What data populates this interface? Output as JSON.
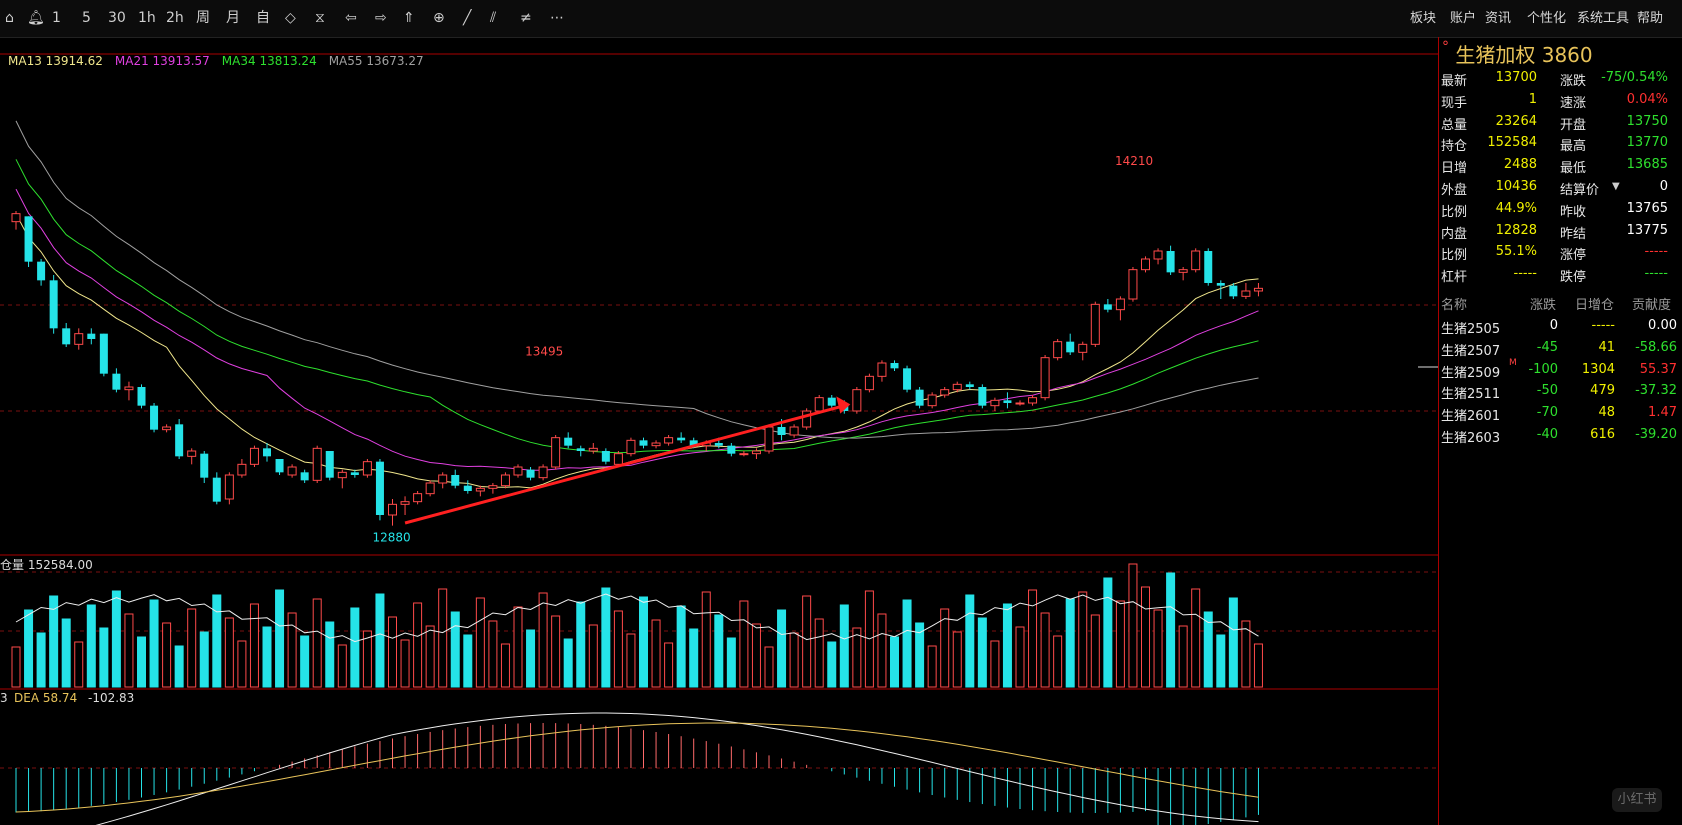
{
  "toolbar": {
    "tools": [
      "house-icon",
      "bell-icon",
      "1",
      "5",
      "30",
      "1h",
      "2h",
      "周",
      "月",
      "自",
      "diamond-icon",
      "hourglass-icon",
      "arrow-left-icon",
      "arrow-right-icon",
      "chevrons-up-icon",
      "crosshair-icon",
      "line-icon",
      "parallel-icon",
      "double-line-icon",
      "more-icon"
    ],
    "menu": [
      "板块",
      "账户",
      "资讯",
      "个性化",
      "系统工具",
      "帮助"
    ]
  },
  "ma_legend": [
    {
      "text": "MA13 13914.62",
      "color": "#f0e68c"
    },
    {
      "text": "MA21 13913.57",
      "color": "#e040e0"
    },
    {
      "text": "MA34 13813.24",
      "color": "#2ee02e"
    },
    {
      "text": "MA55 13673.27",
      "color": "#a0a0a0"
    }
  ],
  "oi_label": "仓量 152584.00",
  "macd_labels": {
    "left": "3",
    "dea": "DEA 58.74",
    "macd": "-102.83"
  },
  "annotations": {
    "high": "14210",
    "mid": "13495",
    "low": "12880"
  },
  "quote": {
    "title": "生猪加权  3860",
    "rows": [
      {
        "l1": "最新",
        "v1": "13700",
        "c1": "#f0f000",
        "l2": "涨跌",
        "v2": "-75/0.54%",
        "c2": "#2ee02e"
      },
      {
        "l1": "现手",
        "v1": "1",
        "c1": "#f0f000",
        "l2": "速涨",
        "v2": "0.04%",
        "c2": "#ff3030"
      },
      {
        "l1": "总量",
        "v1": "23264",
        "c1": "#f0f000",
        "l2": "开盘",
        "v2": "13750",
        "c2": "#2ee02e"
      },
      {
        "l1": "持仓",
        "v1": "152584",
        "c1": "#f0f000",
        "l2": "最高",
        "v2": "13770",
        "c2": "#2ee02e"
      },
      {
        "l1": "日增",
        "v1": "2488",
        "c1": "#f0f000",
        "l2": "最低",
        "v2": "13685",
        "c2": "#2ee02e"
      },
      {
        "l1": "外盘",
        "v1": "10436",
        "c1": "#f0f000",
        "l2": "结算价",
        "v2": "0",
        "c2": "#ffffff"
      },
      {
        "l1": "比例",
        "v1": "44.9%",
        "c1": "#f0f000",
        "l2": "昨收",
        "v2": "13765",
        "c2": "#ffffff"
      },
      {
        "l1": "内盘",
        "v1": "12828",
        "c1": "#f0f000",
        "l2": "昨结",
        "v2": "13775",
        "c2": "#ffffff"
      },
      {
        "l1": "比例",
        "v1": "55.1%",
        "c1": "#f0f000",
        "l2": "涨停",
        "v2": "-----",
        "c2": "#ff3030"
      },
      {
        "l1": "杠杆",
        "v1": "-----",
        "c1": "#f0f000",
        "l2": "跌停",
        "v2": "-----",
        "c2": "#2ee02e"
      }
    ],
    "contracts_header": [
      "名称",
      "涨跌",
      "日增仓",
      "贡献度"
    ],
    "contracts": [
      {
        "name": "生猪2505",
        "chg": "0",
        "chgc": "#ffffff",
        "oi": "-----",
        "oic": "#f0f000",
        "contrib": "0.00",
        "cc": "#ffffff"
      },
      {
        "name": "生猪2507",
        "chg": "-45",
        "chgc": "#2ee02e",
        "oi": "41",
        "oic": "#f0f000",
        "contrib": "-58.66",
        "cc": "#2ee02e"
      },
      {
        "name": "生猪2509",
        "mark": "M",
        "chg": "-100",
        "chgc": "#2ee02e",
        "oi": "1304",
        "oic": "#f0f000",
        "contrib": "55.37",
        "cc": "#ff3030"
      },
      {
        "name": "生猪2511",
        "chg": "-50",
        "chgc": "#2ee02e",
        "oi": "479",
        "oic": "#f0f000",
        "contrib": "-37.32",
        "cc": "#2ee02e"
      },
      {
        "name": "生猪2601",
        "chg": "-70",
        "chgc": "#2ee02e",
        "oi": "48",
        "oic": "#f0f000",
        "contrib": "1.47",
        "cc": "#ff3030"
      },
      {
        "name": "生猪2603",
        "chg": "-40",
        "chgc": "#2ee02e",
        "oi": "616",
        "oic": "#f0f000",
        "contrib": "-39.20",
        "cc": "#2ee02e"
      }
    ]
  },
  "watermark": "小红书",
  "chart_data": {
    "type": "candlestick",
    "ylim": [
      12800,
      14600
    ],
    "candles": [
      [
        14020,
        14060,
        13990,
        14050
      ],
      [
        14040,
        14040,
        13850,
        13870
      ],
      [
        13870,
        13880,
        13780,
        13800
      ],
      [
        13800,
        13820,
        13600,
        13620
      ],
      [
        13620,
        13640,
        13550,
        13560
      ],
      [
        13560,
        13620,
        13540,
        13600
      ],
      [
        13600,
        13620,
        13560,
        13580
      ],
      [
        13600,
        13600,
        13440,
        13450
      ],
      [
        13450,
        13470,
        13380,
        13390
      ],
      [
        13390,
        13420,
        13350,
        13400
      ],
      [
        13400,
        13410,
        13320,
        13330
      ],
      [
        13330,
        13340,
        13230,
        13240
      ],
      [
        13240,
        13260,
        13230,
        13250
      ],
      [
        13260,
        13280,
        13130,
        13140
      ],
      [
        13140,
        13170,
        13110,
        13160
      ],
      [
        13150,
        13160,
        13040,
        13060
      ],
      [
        13060,
        13080,
        12960,
        12970
      ],
      [
        12980,
        13080,
        12960,
        13070
      ],
      [
        13070,
        13130,
        13060,
        13110
      ],
      [
        13110,
        13180,
        13100,
        13170
      ],
      [
        13170,
        13190,
        13120,
        13140
      ],
      [
        13130,
        13130,
        13070,
        13080
      ],
      [
        13070,
        13110,
        13060,
        13100
      ],
      [
        13080,
        13090,
        13040,
        13050
      ],
      [
        13050,
        13180,
        13040,
        13170
      ],
      [
        13160,
        13160,
        13050,
        13060
      ],
      [
        13060,
        13090,
        13020,
        13080
      ],
      [
        13080,
        13090,
        13060,
        13070
      ],
      [
        13070,
        13130,
        13060,
        13120
      ],
      [
        13120,
        13130,
        12900,
        12920
      ],
      [
        12920,
        12980,
        12880,
        12960
      ],
      [
        12960,
        12990,
        12920,
        12970
      ],
      [
        12970,
        13010,
        12960,
        13000
      ],
      [
        13000,
        13050,
        12990,
        13040
      ],
      [
        13040,
        13080,
        13020,
        13070
      ],
      [
        13070,
        13090,
        13020,
        13030
      ],
      [
        13030,
        13050,
        13000,
        13010
      ],
      [
        13010,
        13030,
        12990,
        13020
      ],
      [
        13020,
        13040,
        13000,
        13030
      ],
      [
        13030,
        13080,
        13020,
        13070
      ],
      [
        13070,
        13110,
        13060,
        13100
      ],
      [
        13090,
        13100,
        13050,
        13060
      ],
      [
        13060,
        13110,
        13050,
        13100
      ],
      [
        13100,
        13220,
        13090,
        13210
      ],
      [
        13210,
        13230,
        13170,
        13180
      ],
      [
        13170,
        13180,
        13140,
        13160
      ],
      [
        13160,
        13190,
        13150,
        13170
      ],
      [
        13160,
        13170,
        13110,
        13120
      ],
      [
        13110,
        13160,
        13100,
        13150
      ],
      [
        13150,
        13210,
        13140,
        13200
      ],
      [
        13200,
        13210,
        13170,
        13180
      ],
      [
        13180,
        13200,
        13170,
        13190
      ],
      [
        13190,
        13220,
        13180,
        13210
      ],
      [
        13210,
        13230,
        13190,
        13200
      ],
      [
        13200,
        13210,
        13170,
        13180
      ],
      [
        13180,
        13200,
        13160,
        13190
      ],
      [
        13190,
        13210,
        13170,
        13180
      ],
      [
        13180,
        13190,
        13140,
        13150
      ],
      [
        13150,
        13160,
        13140,
        13150
      ],
      [
        13150,
        13170,
        13130,
        13160
      ],
      [
        13160,
        13260,
        13150,
        13250
      ],
      [
        13250,
        13280,
        13200,
        13220
      ],
      [
        13220,
        13260,
        13210,
        13250
      ],
      [
        13250,
        13320,
        13240,
        13310
      ],
      [
        13310,
        13370,
        13300,
        13360
      ],
      [
        13360,
        13370,
        13320,
        13330
      ],
      [
        13330,
        13350,
        13300,
        13310
      ],
      [
        13310,
        13400,
        13300,
        13390
      ],
      [
        13390,
        13450,
        13380,
        13440
      ],
      [
        13440,
        13500,
        13420,
        13490
      ],
      [
        13490,
        13500,
        13460,
        13470
      ],
      [
        13470,
        13480,
        13380,
        13390
      ],
      [
        13390,
        13400,
        13320,
        13330
      ],
      [
        13330,
        13380,
        13320,
        13370
      ],
      [
        13370,
        13400,
        13360,
        13390
      ],
      [
        13390,
        13420,
        13380,
        13410
      ],
      [
        13410,
        13420,
        13390,
        13400
      ],
      [
        13400,
        13410,
        13320,
        13330
      ],
      [
        13330,
        13360,
        13310,
        13350
      ],
      [
        13350,
        13380,
        13320,
        13340
      ],
      [
        13340,
        13350,
        13330,
        13340
      ],
      [
        13340,
        13370,
        13330,
        13360
      ],
      [
        13360,
        13520,
        13350,
        13510
      ],
      [
        13510,
        13580,
        13500,
        13570
      ],
      [
        13570,
        13600,
        13520,
        13530
      ],
      [
        13530,
        13570,
        13500,
        13560
      ],
      [
        13560,
        13720,
        13550,
        13710
      ],
      [
        13710,
        13730,
        13680,
        13690
      ],
      [
        13690,
        13740,
        13650,
        13730
      ],
      [
        13730,
        13850,
        13720,
        13840
      ],
      [
        13840,
        13890,
        13830,
        13880
      ],
      [
        13880,
        13920,
        13860,
        13910
      ],
      [
        13910,
        13930,
        13820,
        13830
      ],
      [
        13830,
        13850,
        13800,
        13840
      ],
      [
        13840,
        13920,
        13830,
        13910
      ],
      [
        13910,
        13920,
        13780,
        13790
      ],
      [
        13790,
        13800,
        13730,
        13780
      ],
      [
        13780,
        13790,
        13730,
        13740
      ],
      [
        13740,
        13790,
        13730,
        13760
      ],
      [
        13760,
        13790,
        13740,
        13770
      ]
    ]
  }
}
